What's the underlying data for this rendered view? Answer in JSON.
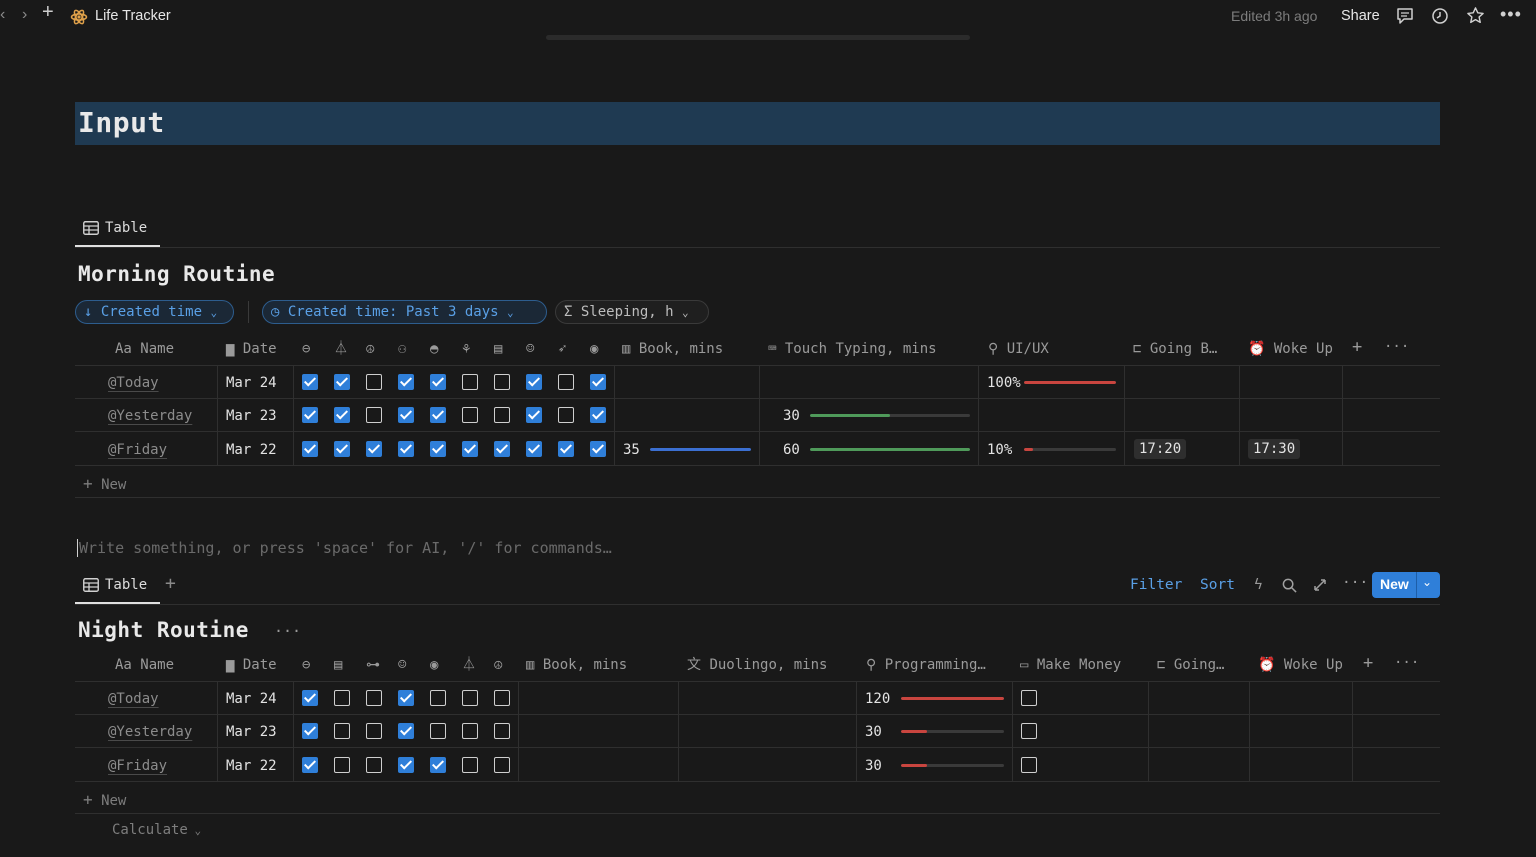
{
  "topbar": {
    "title": "Life Tracker",
    "edited": "Edited 3h ago",
    "share": "Share"
  },
  "page": {
    "heading": "Input",
    "placeholder": "Write something, or press 'space' for AI, '/' for commands…"
  },
  "morning": {
    "tab": "Table",
    "title": "Morning Routine",
    "filters": {
      "sort": "Created time",
      "filter": "Created time: Past 3 days",
      "calc": "Sleeping, h"
    },
    "headers": {
      "name": "Aa Name",
      "date": "Date",
      "book": "Book, mins",
      "typing": "Touch Typing, mins",
      "uiux": "UI/UX",
      "going": "Going B…",
      "woke": "Woke Up"
    },
    "new_label": "New",
    "rows": [
      {
        "name": "@Today",
        "date": "Mar 24",
        "checks": [
          true,
          true,
          false,
          true,
          true,
          false,
          false,
          true,
          false,
          true
        ],
        "book": "",
        "book_pct": 0,
        "typing": "",
        "typing_pct": 0,
        "uiux": "100%",
        "uiux_pct": 100,
        "going": "",
        "woke": ""
      },
      {
        "name": "@Yesterday",
        "date": "Mar 23",
        "checks": [
          true,
          true,
          false,
          true,
          true,
          false,
          false,
          true,
          false,
          true
        ],
        "book": "",
        "book_pct": 0,
        "typing": "30",
        "typing_pct": 50,
        "uiux": "",
        "uiux_pct": 0,
        "going": "",
        "woke": ""
      },
      {
        "name": "@Friday",
        "date": "Mar 22",
        "checks": [
          true,
          true,
          true,
          true,
          true,
          true,
          true,
          true,
          true,
          true
        ],
        "book": "35",
        "book_pct": 100,
        "typing": "60",
        "typing_pct": 100,
        "uiux": "10%",
        "uiux_pct": 10,
        "going": "17:20",
        "woke": "17:30"
      }
    ]
  },
  "night": {
    "tab": "Table",
    "title": "Night Routine",
    "toolbar": {
      "filter": "Filter",
      "sort": "Sort",
      "new": "New"
    },
    "headers": {
      "name": "Aa Name",
      "date": "Date",
      "book": "Book, mins",
      "duolingo": "Duolingo, mins",
      "programming": "Programming…",
      "money": "Make Money",
      "going": "Going…",
      "woke": "Woke Up"
    },
    "new_label": "New",
    "calculate": "Calculate",
    "rows": [
      {
        "name": "@Today",
        "date": "Mar 24",
        "checks": [
          true,
          false,
          false,
          true,
          false,
          false,
          false
        ],
        "programming": "120",
        "programming_pct": 100,
        "money": false
      },
      {
        "name": "@Yesterday",
        "date": "Mar 23",
        "checks": [
          true,
          false,
          false,
          true,
          false,
          false,
          false
        ],
        "programming": "30",
        "programming_pct": 25,
        "money": false
      },
      {
        "name": "@Friday",
        "date": "Mar 22",
        "checks": [
          true,
          false,
          false,
          true,
          true,
          false,
          false
        ],
        "programming": "30",
        "programming_pct": 25,
        "money": false
      }
    ]
  },
  "colors": {
    "accent": "#2f7fd9",
    "bar_red": "#c9453f",
    "bar_green": "#4f9a5a",
    "bar_blue": "#3b6fd1"
  }
}
